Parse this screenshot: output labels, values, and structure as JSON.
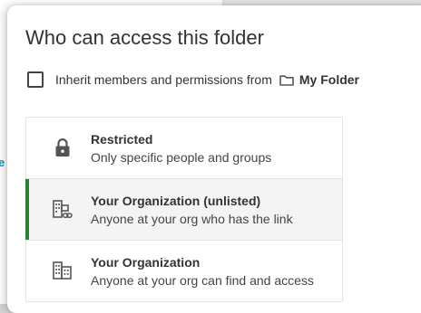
{
  "background": {
    "edge_letter": "e"
  },
  "dialog": {
    "title": "Who can access this folder",
    "inherit": {
      "label": "Inherit members and permissions from",
      "folder_icon": "folder-icon",
      "folder_name": "My Folder",
      "checked": false
    },
    "options": [
      {
        "title": "Restricted",
        "description": "Only specific people and groups",
        "icon": "lock-icon",
        "selected": false
      },
      {
        "title": "Your Organization (unlisted)",
        "description": "Anyone at your org who has the link",
        "icon": "organization-link-icon",
        "selected": true
      },
      {
        "title": "Your Organization",
        "description": "Anyone at your org can find and access",
        "icon": "organization-icon",
        "selected": false
      }
    ],
    "colors": {
      "selected_accent": "#2e7d32",
      "selected_background": "#f4f4f4",
      "link_accent": "#1a8fb0"
    }
  }
}
